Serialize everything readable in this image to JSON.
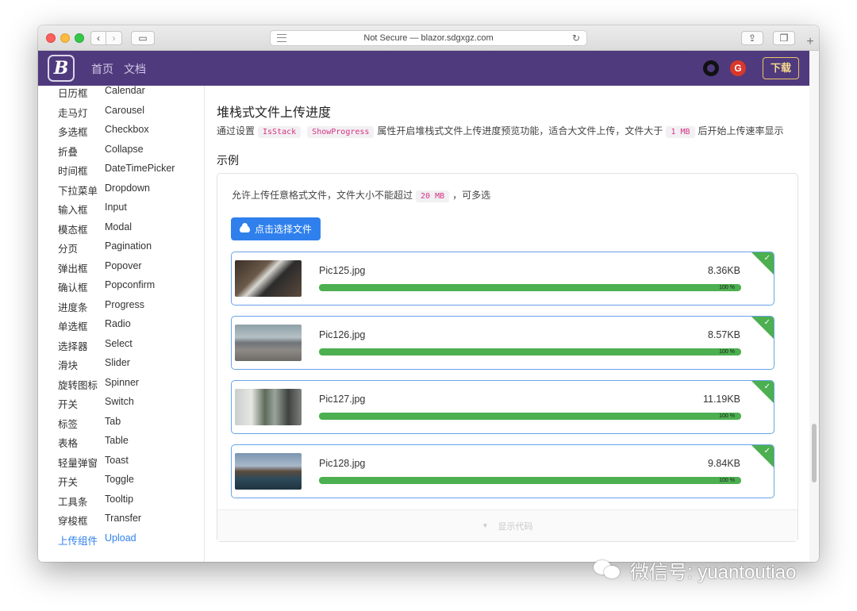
{
  "browser": {
    "address": "Not Secure — blazor.sdgxgz.com"
  },
  "navbar": {
    "logo_text": "B",
    "links": [
      "首页",
      "文档"
    ],
    "gitee_text": "G",
    "download_label": "下载"
  },
  "sidebar": {
    "items": [
      {
        "zh": "日历框",
        "en": "Calendar"
      },
      {
        "zh": "走马灯",
        "en": "Carousel"
      },
      {
        "zh": "多选框",
        "en": "Checkbox"
      },
      {
        "zh": "折叠",
        "en": "Collapse"
      },
      {
        "zh": "时间框",
        "en": "DateTimePicker"
      },
      {
        "zh": "下拉菜单",
        "en": "Dropdown"
      },
      {
        "zh": "输入框",
        "en": "Input"
      },
      {
        "zh": "模态框",
        "en": "Modal"
      },
      {
        "zh": "分页",
        "en": "Pagination"
      },
      {
        "zh": "弹出框",
        "en": "Popover"
      },
      {
        "zh": "确认框",
        "en": "Popconfirm"
      },
      {
        "zh": "进度条",
        "en": "Progress"
      },
      {
        "zh": "单选框",
        "en": "Radio"
      },
      {
        "zh": "选择器",
        "en": "Select"
      },
      {
        "zh": "滑块",
        "en": "Slider"
      },
      {
        "zh": "旋转图标",
        "en": "Spinner"
      },
      {
        "zh": "开关",
        "en": "Switch"
      },
      {
        "zh": "标签",
        "en": "Tab"
      },
      {
        "zh": "表格",
        "en": "Table"
      },
      {
        "zh": "轻量弹窗",
        "en": "Toast"
      },
      {
        "zh": "开关",
        "en": "Toggle"
      },
      {
        "zh": "工具条",
        "en": "Tooltip"
      },
      {
        "zh": "穿梭框",
        "en": "Transfer"
      },
      {
        "zh": "上传组件",
        "en": "Upload"
      }
    ],
    "active_index": 23,
    "active_color": "#2f80ed"
  },
  "content": {
    "title": "堆栈式文件上传进度",
    "desc_prefix": "通过设置",
    "code_isstack": "IsStack",
    "code_showprogress": "ShowProgress",
    "desc_middle": "属性开启堆栈式文件上传进度预览功能，适合大文件上传，文件大于",
    "code_1mb": "1 MB",
    "desc_suffix": "后开始上传速率显示",
    "example_title": "示例",
    "intro_prefix": "允许上传任意格式文件，文件大小不能超过",
    "code_20mb": "20 MB",
    "intro_suffix": "，可多选",
    "upload_button": "点击选择文件",
    "show_code": "显示代码",
    "files": [
      {
        "name": "Pic125.jpg",
        "size": "8.36KB",
        "progress": 100,
        "progress_label": "100 %"
      },
      {
        "name": "Pic126.jpg",
        "size": "8.57KB",
        "progress": 100,
        "progress_label": "100 %"
      },
      {
        "name": "Pic127.jpg",
        "size": "11.19KB",
        "progress": 100,
        "progress_label": "100 %"
      },
      {
        "name": "Pic128.jpg",
        "size": "9.84KB",
        "progress": 100,
        "progress_label": "100 %"
      }
    ]
  },
  "colors": {
    "navbar_bg": "#4f3a7e",
    "primary": "#2f80ed",
    "success": "#4caf50"
  },
  "watermark": {
    "text": "微信号: yuantoutiao"
  }
}
